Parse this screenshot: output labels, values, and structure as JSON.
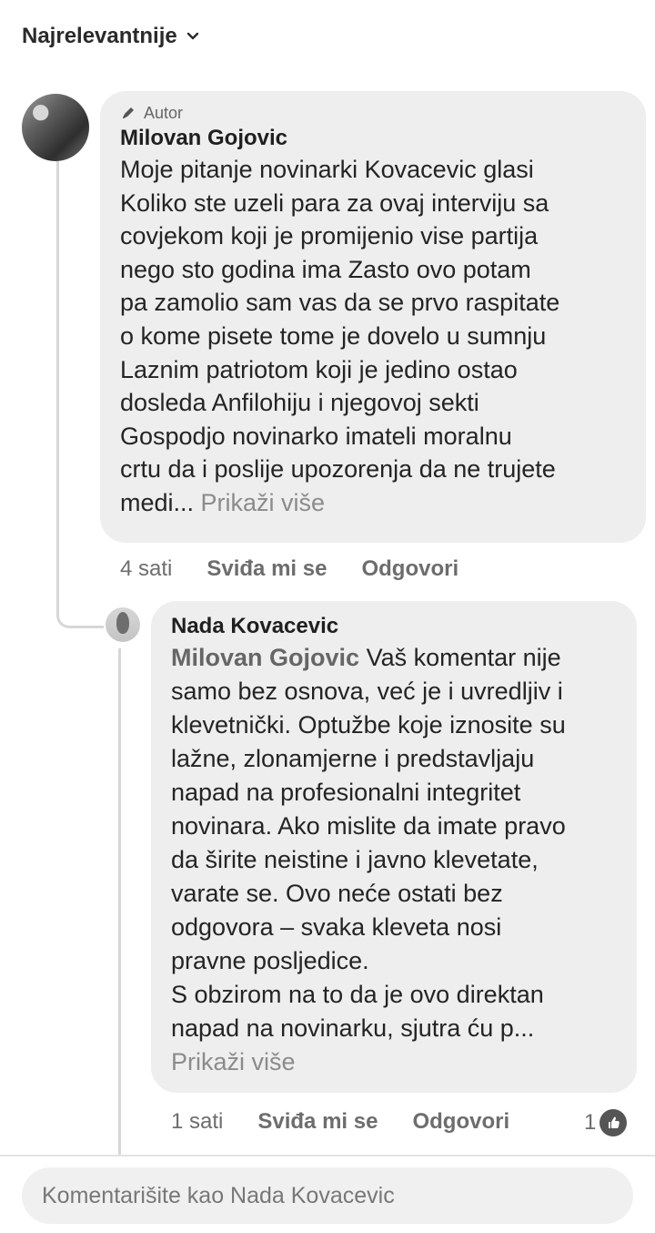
{
  "sort": {
    "label": "Najrelevantnije",
    "icon": "chevron-down-icon"
  },
  "comments": [
    {
      "author_badge": "Autor",
      "name": "Milovan Gojovic",
      "text_lines": [
        "Moje pitanje novinarki  Kovacevic glasi",
        "Koliko ste uzeli para za ovaj interviju sa",
        "covjekom koji je promijenio vise partija",
        "nego sto godina ima    Zasto ovo potam",
        "pa zamolio sam vas da se prvo raspitate",
        "o kome pisete tome je dovelo u sumnju",
        "Laznim patriotom koji je jedino ostao",
        "dosleda Anfilohiju  i njegovoj sekti",
        "Gospodjo novinarko  imateli moralnu",
        "crtu  da i poslije upozorenja da ne trujete",
        "medi..."
      ],
      "see_more": "Prikaži više",
      "time": "4 sati",
      "like": "Sviđa mi se",
      "reply": "Odgovori"
    },
    {
      "name": "Nada Kovacevic",
      "mention": "Milovan Gojovic",
      "text_lines": [
        "Vaš komentar nije",
        "samo bez osnova, već je i uvredljiv i",
        "klevetnički. Optužbe koje iznosite su",
        "lažne, zlonamjerne i predstavljaju",
        "napad na profesionalni integritet",
        "novinara. Ako mislite da imate pravo",
        "da širite neistine i javno klevetate,",
        "varate se. Ovo neće ostati bez",
        "odgovora – svaka kleveta nosi",
        "pravne posljedice.",
        "S obzirom na to da je ovo direktan",
        "napad na novinarku, sjutra ću p..."
      ],
      "see_more": "Prikaži više",
      "time": "1 sati",
      "like": "Sviđa mi se",
      "reply": "Odgovori",
      "reaction_count": "1"
    }
  ],
  "composer": {
    "placeholder": "Komentarišite kao Nada Kovacevic"
  },
  "colors": {
    "bubble": "#eeeeee",
    "text": "#242424",
    "muted": "#6d6d6d"
  },
  "icons": {
    "author_badge": "pencil-icon",
    "reaction": "thumbs-up-icon"
  }
}
